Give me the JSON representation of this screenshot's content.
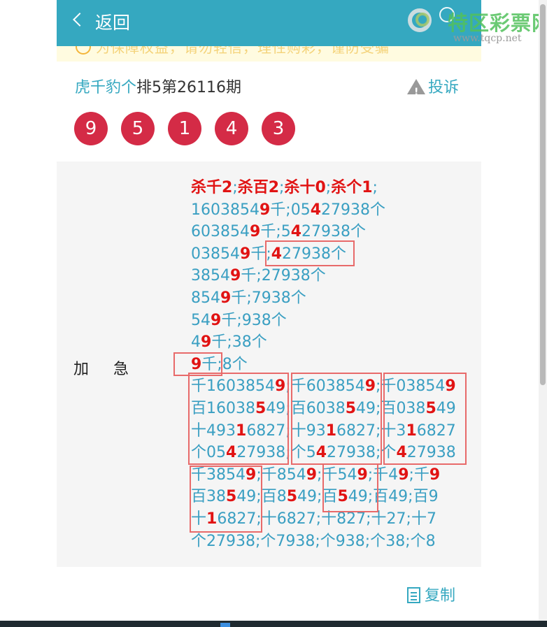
{
  "header": {
    "back_label": "返回",
    "notice_text": "为保障权益，请勿轻信，理性购彩，谨防受骗",
    "watermark_name": "特区彩票网",
    "watermark_url": "www.tqcp.net"
  },
  "post": {
    "author": "虎千豹个",
    "issue": "排5第26116期",
    "report_label": "投诉",
    "balls": [
      "9",
      "5",
      "1",
      "4",
      "3"
    ]
  },
  "card": {
    "label": "加急",
    "kill_line": [
      {
        "t": "杀千2",
        "k": true
      },
      {
        "t": ";",
        "k": false
      },
      {
        "t": "杀百2",
        "k": true
      },
      {
        "t": ";",
        "k": false
      },
      {
        "t": "杀十0",
        "k": true
      },
      {
        "t": ";",
        "k": false
      },
      {
        "t": "杀个1",
        "k": true
      },
      {
        "t": ";",
        "k": false
      }
    ],
    "lines": [
      [
        {
          "t": "160385"
        },
        {
          "t": "4",
          "r": false
        },
        {
          "t": "9",
          "r": true
        },
        {
          "t": "千;05"
        },
        {
          "t": "4",
          "r": true
        },
        {
          "t": "27938个"
        }
      ],
      [
        {
          "t": "60385"
        },
        {
          "t": "4"
        },
        {
          "t": "9",
          "r": true
        },
        {
          "t": "千;5"
        },
        {
          "t": "4",
          "r": true
        },
        {
          "t": "27938个"
        }
      ],
      [
        {
          "t": "03854"
        },
        {
          "t": "9",
          "r": true
        },
        {
          "t": "千;"
        },
        {
          "t": "4",
          "r": true
        },
        {
          "t": "27938个"
        }
      ],
      [
        {
          "t": "3854"
        },
        {
          "t": "9",
          "r": true
        },
        {
          "t": "千;27938个"
        }
      ],
      [
        {
          "t": "854"
        },
        {
          "t": "9",
          "r": true
        },
        {
          "t": "千;7938个"
        }
      ],
      [
        {
          "t": "54"
        },
        {
          "t": "9",
          "r": true
        },
        {
          "t": "千;938个"
        }
      ],
      [
        {
          "t": "4"
        },
        {
          "t": "9",
          "r": true
        },
        {
          "t": "千;38个"
        }
      ],
      [
        {
          "t": "9",
          "r": true
        },
        {
          "t": "千;8个"
        }
      ],
      [
        {
          "t": "千160385"
        },
        {
          "t": "4"
        },
        {
          "t": "9",
          "r": true
        },
        {
          "t": ";千603854"
        },
        {
          "t": "9",
          "r": true
        },
        {
          "t": ";千03854"
        },
        {
          "t": "9",
          "r": true
        }
      ],
      [
        {
          "t": "百16038"
        },
        {
          "t": "5",
          "r": true
        },
        {
          "t": "49;百6038"
        },
        {
          "t": "5",
          "r": true
        },
        {
          "t": "49;百038"
        },
        {
          "t": "5",
          "r": true
        },
        {
          "t": "49"
        }
      ],
      [
        {
          "t": "十493"
        },
        {
          "t": "1",
          "r": true
        },
        {
          "t": "6827;十93"
        },
        {
          "t": "1",
          "r": true
        },
        {
          "t": "6827;十3"
        },
        {
          "t": "1",
          "r": true
        },
        {
          "t": "6827"
        }
      ],
      [
        {
          "t": "个05"
        },
        {
          "t": "4",
          "r": true
        },
        {
          "t": "27938;个5"
        },
        {
          "t": "4",
          "r": true
        },
        {
          "t": "27938;个"
        },
        {
          "t": "4",
          "r": true
        },
        {
          "t": "27938"
        }
      ],
      [
        {
          "t": "千3854"
        },
        {
          "t": "9",
          "r": true
        },
        {
          "t": ";千854"
        },
        {
          "t": "9",
          "r": true
        },
        {
          "t": ";千54"
        },
        {
          "t": "9",
          "r": true
        },
        {
          "t": ";千4"
        },
        {
          "t": "9",
          "r": true
        },
        {
          "t": ";千"
        },
        {
          "t": "9",
          "r": true
        }
      ],
      [
        {
          "t": "百38"
        },
        {
          "t": "5",
          "r": true
        },
        {
          "t": "49;百8"
        },
        {
          "t": "5",
          "r": true
        },
        {
          "t": "49;百"
        },
        {
          "t": "5",
          "r": true
        },
        {
          "t": "49;百49;百9"
        }
      ],
      [
        {
          "t": "十"
        },
        {
          "t": "1",
          "r": true
        },
        {
          "t": "6827;十6827;十827;十27;十7"
        }
      ],
      [
        {
          "t": "个27938;个7938;个938;个38;个8"
        }
      ]
    ]
  },
  "footer": {
    "copy_label": "复制"
  }
}
